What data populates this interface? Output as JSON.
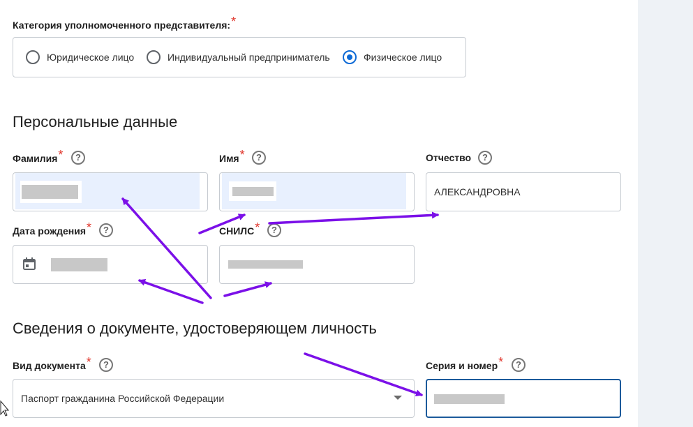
{
  "representative": {
    "label": "Категория уполномоченного представителя:",
    "required_mark": "*",
    "options": [
      {
        "label": "Юридическое лицо",
        "checked": false
      },
      {
        "label": "Индивидуальный предприниматель",
        "checked": false
      },
      {
        "label": "Физическое лицо",
        "checked": true
      }
    ]
  },
  "personal": {
    "heading": "Персональные данные",
    "surname_label": "Фамилия",
    "name_label": "Имя",
    "patronymic_label": "Отчество",
    "patronymic_value": "АЛЕКСАНДРОВНА",
    "birthdate_label": "Дата рождения",
    "snils_label": "СНИЛС",
    "required_mark": "*",
    "help_glyph": "?"
  },
  "document": {
    "heading": "Сведения о документе, удостоверяющем личность",
    "type_label": "Вид документа",
    "type_value": "Паспорт гражданина Российской Федерации",
    "series_label": "Серия и номер",
    "required_mark": "*",
    "help_glyph": "?"
  },
  "icons": {
    "calendar": "calendar-icon",
    "help": "help-icon",
    "dropdown": "chevron-down-icon"
  },
  "colors": {
    "required": "#e0352b",
    "radio_checked": "#0d6ad6",
    "autofill_bg": "#e8f0fe",
    "focus_border": "#1c5a9b",
    "annotation_arrow": "#7b10e8",
    "side_panel": "#eef2f6"
  }
}
